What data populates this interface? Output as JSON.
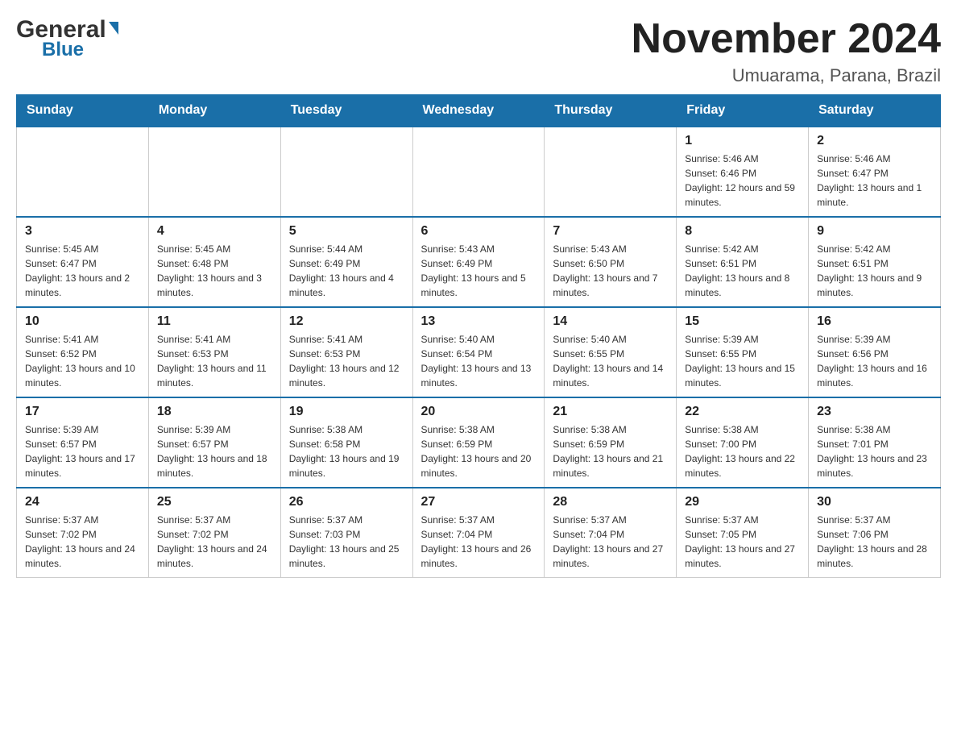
{
  "logo": {
    "general": "General",
    "triangle": "",
    "blue": "Blue"
  },
  "header": {
    "month_year": "November 2024",
    "location": "Umuarama, Parana, Brazil"
  },
  "weekdays": [
    "Sunday",
    "Monday",
    "Tuesday",
    "Wednesday",
    "Thursday",
    "Friday",
    "Saturday"
  ],
  "weeks": [
    [
      {
        "day": "",
        "info": ""
      },
      {
        "day": "",
        "info": ""
      },
      {
        "day": "",
        "info": ""
      },
      {
        "day": "",
        "info": ""
      },
      {
        "day": "",
        "info": ""
      },
      {
        "day": "1",
        "info": "Sunrise: 5:46 AM\nSunset: 6:46 PM\nDaylight: 12 hours and 59 minutes."
      },
      {
        "day": "2",
        "info": "Sunrise: 5:46 AM\nSunset: 6:47 PM\nDaylight: 13 hours and 1 minute."
      }
    ],
    [
      {
        "day": "3",
        "info": "Sunrise: 5:45 AM\nSunset: 6:47 PM\nDaylight: 13 hours and 2 minutes."
      },
      {
        "day": "4",
        "info": "Sunrise: 5:45 AM\nSunset: 6:48 PM\nDaylight: 13 hours and 3 minutes."
      },
      {
        "day": "5",
        "info": "Sunrise: 5:44 AM\nSunset: 6:49 PM\nDaylight: 13 hours and 4 minutes."
      },
      {
        "day": "6",
        "info": "Sunrise: 5:43 AM\nSunset: 6:49 PM\nDaylight: 13 hours and 5 minutes."
      },
      {
        "day": "7",
        "info": "Sunrise: 5:43 AM\nSunset: 6:50 PM\nDaylight: 13 hours and 7 minutes."
      },
      {
        "day": "8",
        "info": "Sunrise: 5:42 AM\nSunset: 6:51 PM\nDaylight: 13 hours and 8 minutes."
      },
      {
        "day": "9",
        "info": "Sunrise: 5:42 AM\nSunset: 6:51 PM\nDaylight: 13 hours and 9 minutes."
      }
    ],
    [
      {
        "day": "10",
        "info": "Sunrise: 5:41 AM\nSunset: 6:52 PM\nDaylight: 13 hours and 10 minutes."
      },
      {
        "day": "11",
        "info": "Sunrise: 5:41 AM\nSunset: 6:53 PM\nDaylight: 13 hours and 11 minutes."
      },
      {
        "day": "12",
        "info": "Sunrise: 5:41 AM\nSunset: 6:53 PM\nDaylight: 13 hours and 12 minutes."
      },
      {
        "day": "13",
        "info": "Sunrise: 5:40 AM\nSunset: 6:54 PM\nDaylight: 13 hours and 13 minutes."
      },
      {
        "day": "14",
        "info": "Sunrise: 5:40 AM\nSunset: 6:55 PM\nDaylight: 13 hours and 14 minutes."
      },
      {
        "day": "15",
        "info": "Sunrise: 5:39 AM\nSunset: 6:55 PM\nDaylight: 13 hours and 15 minutes."
      },
      {
        "day": "16",
        "info": "Sunrise: 5:39 AM\nSunset: 6:56 PM\nDaylight: 13 hours and 16 minutes."
      }
    ],
    [
      {
        "day": "17",
        "info": "Sunrise: 5:39 AM\nSunset: 6:57 PM\nDaylight: 13 hours and 17 minutes."
      },
      {
        "day": "18",
        "info": "Sunrise: 5:39 AM\nSunset: 6:57 PM\nDaylight: 13 hours and 18 minutes."
      },
      {
        "day": "19",
        "info": "Sunrise: 5:38 AM\nSunset: 6:58 PM\nDaylight: 13 hours and 19 minutes."
      },
      {
        "day": "20",
        "info": "Sunrise: 5:38 AM\nSunset: 6:59 PM\nDaylight: 13 hours and 20 minutes."
      },
      {
        "day": "21",
        "info": "Sunrise: 5:38 AM\nSunset: 6:59 PM\nDaylight: 13 hours and 21 minutes."
      },
      {
        "day": "22",
        "info": "Sunrise: 5:38 AM\nSunset: 7:00 PM\nDaylight: 13 hours and 22 minutes."
      },
      {
        "day": "23",
        "info": "Sunrise: 5:38 AM\nSunset: 7:01 PM\nDaylight: 13 hours and 23 minutes."
      }
    ],
    [
      {
        "day": "24",
        "info": "Sunrise: 5:37 AM\nSunset: 7:02 PM\nDaylight: 13 hours and 24 minutes."
      },
      {
        "day": "25",
        "info": "Sunrise: 5:37 AM\nSunset: 7:02 PM\nDaylight: 13 hours and 24 minutes."
      },
      {
        "day": "26",
        "info": "Sunrise: 5:37 AM\nSunset: 7:03 PM\nDaylight: 13 hours and 25 minutes."
      },
      {
        "day": "27",
        "info": "Sunrise: 5:37 AM\nSunset: 7:04 PM\nDaylight: 13 hours and 26 minutes."
      },
      {
        "day": "28",
        "info": "Sunrise: 5:37 AM\nSunset: 7:04 PM\nDaylight: 13 hours and 27 minutes."
      },
      {
        "day": "29",
        "info": "Sunrise: 5:37 AM\nSunset: 7:05 PM\nDaylight: 13 hours and 27 minutes."
      },
      {
        "day": "30",
        "info": "Sunrise: 5:37 AM\nSunset: 7:06 PM\nDaylight: 13 hours and 28 minutes."
      }
    ]
  ]
}
